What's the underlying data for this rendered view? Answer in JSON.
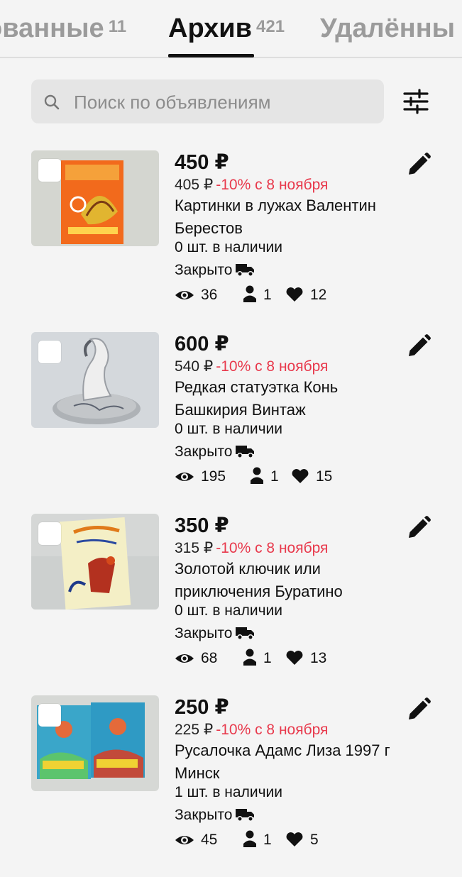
{
  "tabs": [
    {
      "label": "ованные",
      "count": "11"
    },
    {
      "label": "Архив",
      "count": "421"
    },
    {
      "label": "Удалённы",
      "count": ""
    }
  ],
  "search": {
    "placeholder": "Поиск по объявлениям"
  },
  "icons": {
    "search": "search-icon",
    "filter": "sliders-icon",
    "edit": "pencil-icon",
    "delivery": "truck-icon",
    "views": "eye-icon",
    "contacts": "person-icon",
    "favorites": "heart-icon"
  },
  "colors": {
    "accent": "#e8394c",
    "text": "#111111",
    "muted": "#9b9b9b",
    "background": "#f4f4f4"
  },
  "listings": [
    {
      "price": "450 ₽",
      "old_price": "405 ₽",
      "discount": "-10% с 8 ноября",
      "title": "Картинки в лужах Валентин Берестов",
      "stock": "0 шт. в наличии",
      "status": "Закрыто",
      "views": "36",
      "contacts": "1",
      "favorites": "12"
    },
    {
      "price": "600 ₽",
      "old_price": "540 ₽",
      "discount": "-10% с 8 ноября",
      "title": "Редкая статуэтка Конь Башкирия Винтаж",
      "stock": "0 шт. в наличии",
      "status": "Закрыто",
      "views": "195",
      "contacts": "1",
      "favorites": "15"
    },
    {
      "price": "350 ₽",
      "old_price": "315 ₽",
      "discount": "-10% с 8 ноября",
      "title": "Золотой ключик или приключения Буратино",
      "stock": "0 шт. в наличии",
      "status": "Закрыто",
      "views": "68",
      "contacts": "1",
      "favorites": "13"
    },
    {
      "price": "250 ₽",
      "old_price": "225 ₽",
      "discount": "-10% с 8 ноября",
      "title": "Русалочка Адамс Лиза 1997 г Минск",
      "stock": "1 шт. в наличии",
      "status": "Закрыто",
      "views": "45",
      "contacts": "1",
      "favorites": "5"
    }
  ]
}
